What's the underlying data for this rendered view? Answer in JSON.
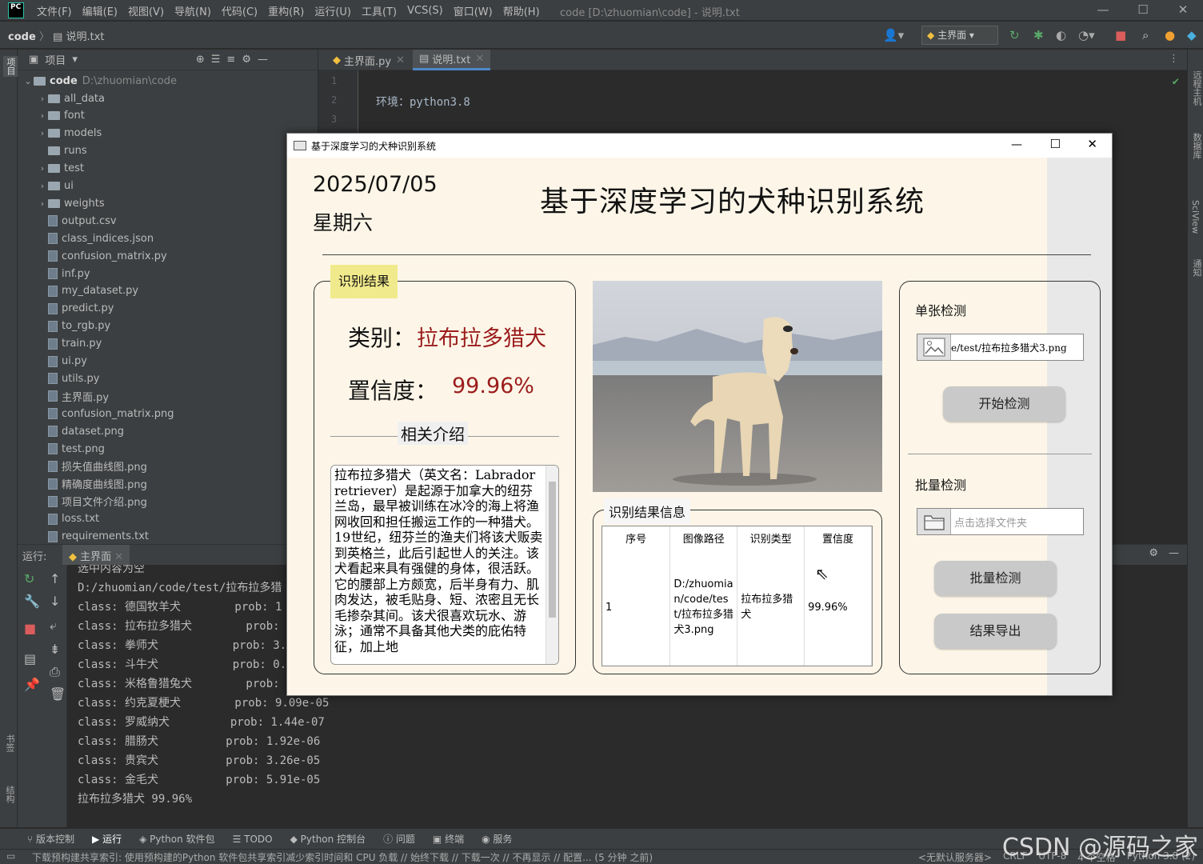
{
  "ide": {
    "logo": "PC",
    "menu": [
      "文件(F)",
      "编辑(E)",
      "视图(V)",
      "导航(N)",
      "代码(C)",
      "重构(R)",
      "运行(U)",
      "工具(T)",
      "VCS(S)",
      "窗口(W)",
      "帮助(H)"
    ],
    "window_title": "code [D:\\zhuomian\\code] - 说明.txt",
    "breadcrumb_root": "code",
    "breadcrumb_file": "说明.txt",
    "run_config": "主界面",
    "project_label": "项目",
    "tree_root": {
      "name": "code",
      "path": "D:\\zhuomian\\code"
    },
    "tree": [
      {
        "name": "all_data",
        "type": "folder",
        "expandable": true
      },
      {
        "name": "font",
        "type": "folder",
        "expandable": true
      },
      {
        "name": "models",
        "type": "folder",
        "expandable": true
      },
      {
        "name": "runs",
        "type": "folder",
        "expandable": false
      },
      {
        "name": "test",
        "type": "folder",
        "expandable": true
      },
      {
        "name": "ui",
        "type": "folder",
        "expandable": true
      },
      {
        "name": "weights",
        "type": "folder",
        "expandable": true
      },
      {
        "name": "output.csv",
        "type": "file"
      },
      {
        "name": "class_indices.json",
        "type": "file"
      },
      {
        "name": "confusion_matrix.py",
        "type": "file"
      },
      {
        "name": "inf.py",
        "type": "file"
      },
      {
        "name": "my_dataset.py",
        "type": "file"
      },
      {
        "name": "predict.py",
        "type": "file"
      },
      {
        "name": "to_rgb.py",
        "type": "file"
      },
      {
        "name": "train.py",
        "type": "file"
      },
      {
        "name": "ui.py",
        "type": "file"
      },
      {
        "name": "utils.py",
        "type": "file"
      },
      {
        "name": "主界面.py",
        "type": "file"
      },
      {
        "name": "confusion_matrix.png",
        "type": "file"
      },
      {
        "name": "dataset.png",
        "type": "file"
      },
      {
        "name": "test.png",
        "type": "file"
      },
      {
        "name": "损失值曲线图.png",
        "type": "file"
      },
      {
        "name": "精确度曲线图.png",
        "type": "file"
      },
      {
        "name": "项目文件介绍.png",
        "type": "file"
      },
      {
        "name": "loss.txt",
        "type": "file"
      },
      {
        "name": "requirements.txt",
        "type": "file"
      }
    ],
    "editor_tabs": [
      "主界面.py",
      "说明.txt"
    ],
    "line_numbers": [
      "1",
      "2",
      "3"
    ],
    "code_line_2": "环境：python3.8",
    "run_label": "运行:",
    "run_tab": "主界面",
    "console": [
      "选中内容为空",
      "D:/zhuomian/code/test/拉布拉多猎",
      "class: 德国牧羊犬        prob: 1",
      "class: 拉布拉多猎犬        prob: ",
      "class: 拳师犬           prob: 3.",
      "class: 斗牛犬           prob: 0.",
      "class: 米格鲁猎兔犬        prob: ",
      "class: 约克夏梗犬        prob: 9.09e-05",
      "class: 罗威纳犬         prob: 1.44e-07",
      "class: 腊肠犬          prob: 1.92e-06",
      "class: 贵宾犬          prob: 3.26e-05",
      "class: 金毛犬          prob: 5.91e-05",
      "拉布拉多猎犬 99.96%"
    ],
    "bottom_tools": [
      "版本控制",
      "运行",
      "Python 软件包",
      "TODO",
      "Python 控制台",
      "问题",
      "终端",
      "服务"
    ],
    "status_left": "下载预构建共享索引: 使用预构建的Python 软件包共享索引减少索引时间和 CPU 负载 // 始终下载 // 下载一次 // 不再显示 // 配置... (5 分钟 之前)",
    "status_right": [
      "<无默认服务器>",
      "CRLF",
      "UTF-8",
      "4 个空格",
      "Python 3.8 (2)"
    ],
    "right_stripe": [
      "远程主机",
      "数据库",
      "SciView",
      "通知"
    ],
    "left_stripe_bottom": [
      "书签",
      "结构"
    ],
    "watermark": "CSDN @源码之家"
  },
  "app": {
    "window_title": "基于深度学习的犬种识别系统",
    "date": "2025/07/05",
    "weekday": "星期六",
    "heading": "基于深度学习的犬种识别系统",
    "result_box_label": "识别结果",
    "category_label": "类别：",
    "category_value": "拉布拉多猎犬",
    "confidence_label": "置信度：",
    "confidence_value": "99.96%",
    "intro_label": "相关介绍",
    "intro_text": "拉布拉多猎犬（英文名：Labrador retriever）是起源于加拿大的纽芬兰岛，最早被训练在冰冷的海上将渔网收回和担任搬运工作的一种猎犬。19世纪，纽芬兰的渔夫们将该犬贩卖到英格兰，此后引起世人的关注。该犬看起来具有强健的身体，很活跃。它的腰部上方颇宽，后半身有力、肌肉发达，被毛贴身、短、浓密且无长毛掺杂其间。该犬很喜欢玩水、游泳；通常不具备其他犬类的庇佑特征，加上地",
    "info_box_label": "识别结果信息",
    "table": {
      "headers": [
        "序号",
        "图像路径",
        "识别类型",
        "置信度"
      ],
      "rows": [
        [
          "1",
          "D:/zhuomian/code/test/拉布拉多猎犬3.png",
          "拉布拉多猎犬",
          "99.96%"
        ]
      ]
    },
    "single_label": "单张检测",
    "single_path": "e/test/拉布拉多猎犬3.png",
    "start_button": "开始检测",
    "batch_label": "批量检测",
    "batch_placeholder": "点击选择文件夹",
    "batch_button": "批量检测",
    "export_button": "结果导出",
    "colors": {
      "accent_red": "#9b1c1c",
      "label_bg": "#f1ea8c",
      "panel_bg": "#fdf6e8"
    }
  }
}
